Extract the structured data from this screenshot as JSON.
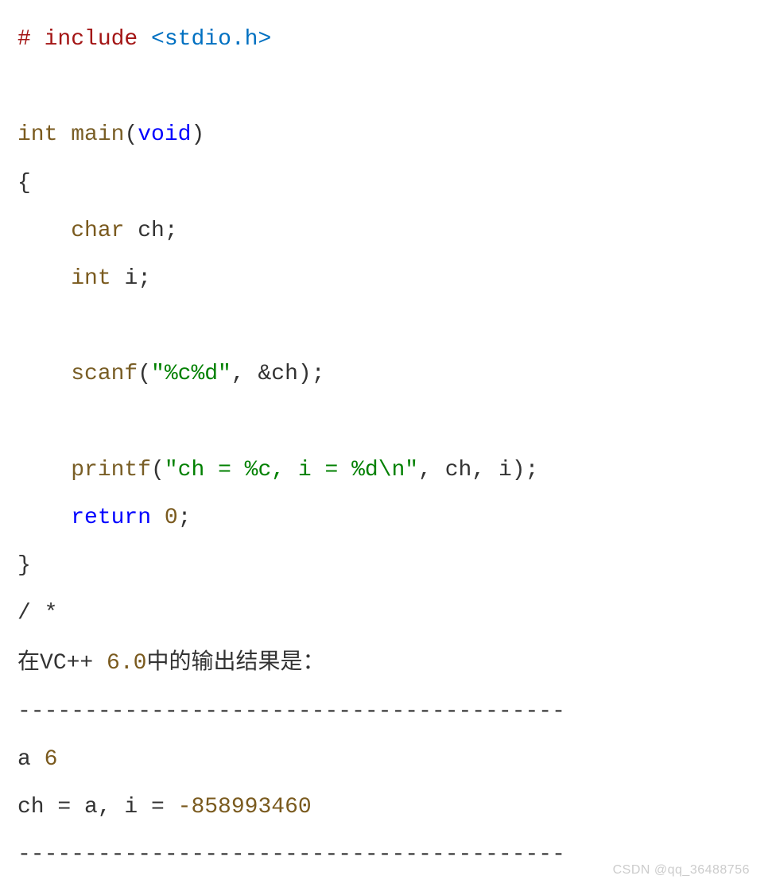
{
  "code": {
    "preproc_hash": "#",
    "preproc_word": " include ",
    "include_open": "<",
    "include_file": "stdio.h",
    "include_close": ">",
    "kw_int": "int",
    "fn_main": " main",
    "main_args_open": "(",
    "kw_void": "void",
    "main_args_close": ")",
    "brace_open": "{",
    "indent": "    ",
    "kw_char": "char",
    "var_ch": " ch",
    "semi": ";",
    "kw_int2": "int",
    "var_i": " i",
    "fn_scanf": "scanf",
    "paren_open": "(",
    "str_scanf": "\"%c%d\"",
    "comma_sp": ", ",
    "amp_ch": "&ch",
    "paren_close": ")",
    "fn_printf": "printf",
    "str_printf": "\"ch = %c, i = %d\\n\"",
    "arg_ch": "ch",
    "arg_i": "i",
    "kw_return": "return",
    "num_zero": " 0",
    "brace_close": "}",
    "comment_open": "/ *",
    "cn_prefix": "在",
    "vcpp": "VC++ ",
    "ver": "6.0",
    "cn_suffix": "中的输出结果是：",
    "dashes": "-----------------------------------------",
    "out_a": "a ",
    "out_6": "6",
    "out_ch_eq": "ch = a, i = ",
    "out_val": "-858993460"
  },
  "watermark": "CSDN @qq_36488756"
}
